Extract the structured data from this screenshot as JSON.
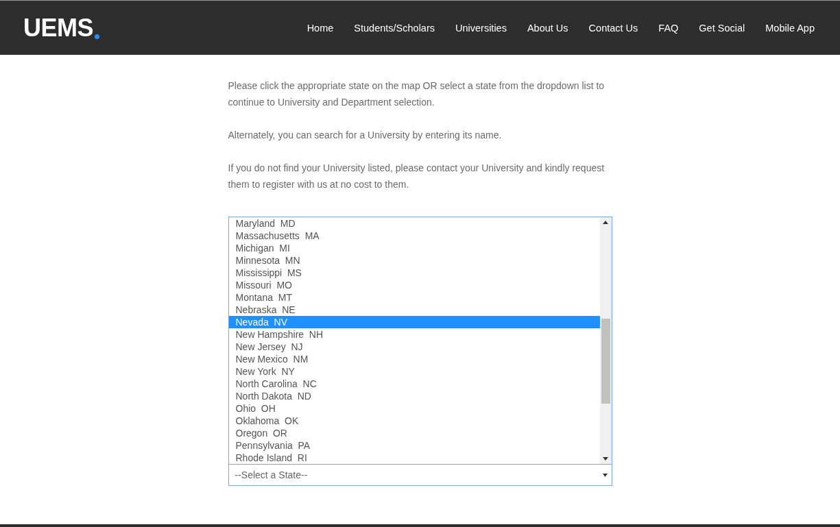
{
  "header": {
    "logo": "UEMS",
    "nav": [
      {
        "label": "Home"
      },
      {
        "label": "Students/Scholars"
      },
      {
        "label": "Universities"
      },
      {
        "label": "About Us"
      },
      {
        "label": "Contact Us"
      },
      {
        "label": "FAQ"
      },
      {
        "label": "Get Social"
      },
      {
        "label": "Mobile App"
      }
    ]
  },
  "paragraphs": [
    "Please click the appropriate state on the map OR select a state from the dropdown list to continue to University and Department selection.",
    "Alternately, you can search for a University by entering its name.",
    "If you do not find your University listed, please contact your University and kindly request them to register with us at no cost to them."
  ],
  "state_list": {
    "options": [
      {
        "label": "Maryland  MD",
        "selected": false
      },
      {
        "label": "Massachusetts  MA",
        "selected": false
      },
      {
        "label": "Michigan  MI",
        "selected": false
      },
      {
        "label": "Minnesota  MN",
        "selected": false
      },
      {
        "label": "Mississippi  MS",
        "selected": false
      },
      {
        "label": "Missouri  MO",
        "selected": false
      },
      {
        "label": "Montana  MT",
        "selected": false
      },
      {
        "label": "Nebraska  NE",
        "selected": false
      },
      {
        "label": "Nevada  NV",
        "selected": true
      },
      {
        "label": "New Hampshire  NH",
        "selected": false
      },
      {
        "label": "New Jersey  NJ",
        "selected": false
      },
      {
        "label": "New Mexico  NM",
        "selected": false
      },
      {
        "label": "New York  NY",
        "selected": false
      },
      {
        "label": "North Carolina  NC",
        "selected": false
      },
      {
        "label": "North Dakota  ND",
        "selected": false
      },
      {
        "label": "Ohio  OH",
        "selected": false
      },
      {
        "label": "Oklahoma  OK",
        "selected": false
      },
      {
        "label": "Oregon  OR",
        "selected": false
      },
      {
        "label": "Pennsylvania  PA",
        "selected": false
      },
      {
        "label": "Rhode Island  RI",
        "selected": false
      }
    ]
  },
  "state_select": {
    "value": "--Select a State--"
  }
}
